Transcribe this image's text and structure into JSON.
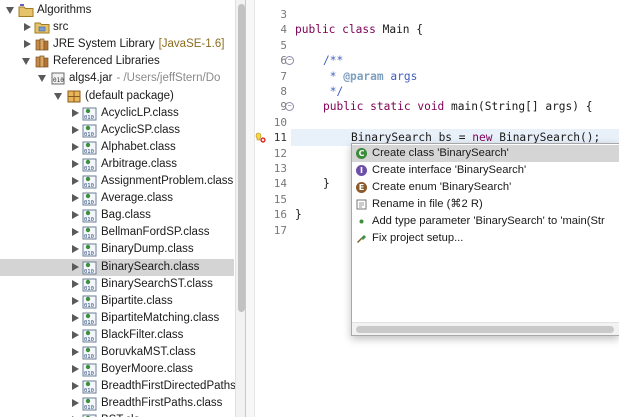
{
  "explorer": {
    "items": [
      {
        "label": "Algorithms",
        "suffix": "",
        "depth": 0,
        "expand": "open",
        "icon": "project-icon"
      },
      {
        "label": "src",
        "suffix": "",
        "depth": 1,
        "expand": "closed",
        "icon": "source-folder-icon"
      },
      {
        "label": "JRE System Library",
        "suffix": "[JavaSE-1.6]",
        "depth": 1,
        "expand": "closed",
        "icon": "library-icon"
      },
      {
        "label": "Referenced Libraries",
        "suffix": "",
        "depth": 1,
        "expand": "open",
        "icon": "library-icon"
      },
      {
        "label": "algs4.jar",
        "suffix": "- /Users/jeffStern/Do",
        "depth": 2,
        "expand": "open",
        "icon": "jar-icon"
      },
      {
        "label": "(default package)",
        "suffix": "",
        "depth": 3,
        "expand": "open",
        "icon": "package-icon"
      },
      {
        "label": "AcyclicLP.class",
        "suffix": "",
        "depth": 4,
        "expand": "closed",
        "icon": "class-file-icon"
      },
      {
        "label": "AcyclicSP.class",
        "suffix": "",
        "depth": 4,
        "expand": "closed",
        "icon": "class-file-icon"
      },
      {
        "label": "Alphabet.class",
        "suffix": "",
        "depth": 4,
        "expand": "closed",
        "icon": "class-file-icon"
      },
      {
        "label": "Arbitrage.class",
        "suffix": "",
        "depth": 4,
        "expand": "closed",
        "icon": "class-file-icon"
      },
      {
        "label": "AssignmentProblem.class",
        "suffix": "",
        "depth": 4,
        "expand": "closed",
        "icon": "class-file-icon"
      },
      {
        "label": "Average.class",
        "suffix": "",
        "depth": 4,
        "expand": "closed",
        "icon": "class-file-icon"
      },
      {
        "label": "Bag.class",
        "suffix": "",
        "depth": 4,
        "expand": "closed",
        "icon": "class-file-icon"
      },
      {
        "label": "BellmanFordSP.class",
        "suffix": "",
        "depth": 4,
        "expand": "closed",
        "icon": "class-file-icon"
      },
      {
        "label": "BinaryDump.class",
        "suffix": "",
        "depth": 4,
        "expand": "closed",
        "icon": "class-file-icon"
      },
      {
        "label": "BinarySearch.class",
        "suffix": "",
        "depth": 4,
        "expand": "closed",
        "icon": "class-file-icon",
        "selected": true
      },
      {
        "label": "BinarySearchST.class",
        "suffix": "",
        "depth": 4,
        "expand": "closed",
        "icon": "class-file-icon"
      },
      {
        "label": "Bipartite.class",
        "suffix": "",
        "depth": 4,
        "expand": "closed",
        "icon": "class-file-icon"
      },
      {
        "label": "BipartiteMatching.class",
        "suffix": "",
        "depth": 4,
        "expand": "closed",
        "icon": "class-file-icon"
      },
      {
        "label": "BlackFilter.class",
        "suffix": "",
        "depth": 4,
        "expand": "closed",
        "icon": "class-file-icon"
      },
      {
        "label": "BoruvkaMST.class",
        "suffix": "",
        "depth": 4,
        "expand": "closed",
        "icon": "class-file-icon"
      },
      {
        "label": "BoyerMoore.class",
        "suffix": "",
        "depth": 4,
        "expand": "closed",
        "icon": "class-file-icon"
      },
      {
        "label": "BreadthFirstDirectedPaths",
        "suffix": "",
        "depth": 4,
        "expand": "closed",
        "icon": "class-file-icon"
      },
      {
        "label": "BreadthFirstPaths.class",
        "suffix": "",
        "depth": 4,
        "expand": "closed",
        "icon": "class-file-icon"
      },
      {
        "label": "BST.cla",
        "suffix": "",
        "depth": 4,
        "expand": "closed",
        "icon": "class-file-icon"
      }
    ]
  },
  "editor": {
    "line_numbers": [
      "3",
      "4",
      "5",
      "6",
      "7",
      "8",
      "9",
      "10",
      "11",
      "12",
      "13",
      "14",
      "15",
      "16",
      "17"
    ],
    "current_line_number": "11",
    "fold_markers": [
      "6",
      "9"
    ],
    "error_line": "11",
    "code": {
      "l4_kw1": "public",
      "l4_kw2": "class",
      "l4_rest": " Main {",
      "l6": "/**",
      "l7_star": " * ",
      "l7_tag": "@param",
      "l7_rest": " args",
      "l8": " */",
      "l9_kw1": "public",
      "l9_kw2": "static",
      "l9_kw3": "void",
      "l9_rest": " main(String[] args) {",
      "l11_type": "BinarySearch",
      "l11_mid": " bs = ",
      "l11_kw": "new",
      "l11_ctor": "BinarySearch",
      "l11_end": "();",
      "l14": "}",
      "l16": "}"
    }
  },
  "quickfix": {
    "items": [
      {
        "label": "Create class 'BinarySearch'",
        "icon": "create-class-icon",
        "color": "#3c8c3c",
        "glyph": "C",
        "selected": true
      },
      {
        "label": "Create interface 'BinarySearch'",
        "icon": "create-interface-icon",
        "color": "#6b4fa8",
        "glyph": "I"
      },
      {
        "label": "Create enum 'BinarySearch'",
        "icon": "create-enum-icon",
        "color": "#8a5a2b",
        "glyph": "E"
      },
      {
        "label": "Rename in file (⌘2 R)",
        "icon": "rename-icon",
        "color": "",
        "glyph": ""
      },
      {
        "label": "Add type parameter 'BinarySearch' to 'main(Str",
        "icon": "add-type-parameter-icon",
        "color": "",
        "glyph": ""
      },
      {
        "label": "Fix project setup...",
        "icon": "fix-project-icon",
        "color": "",
        "glyph": ""
      }
    ]
  }
}
